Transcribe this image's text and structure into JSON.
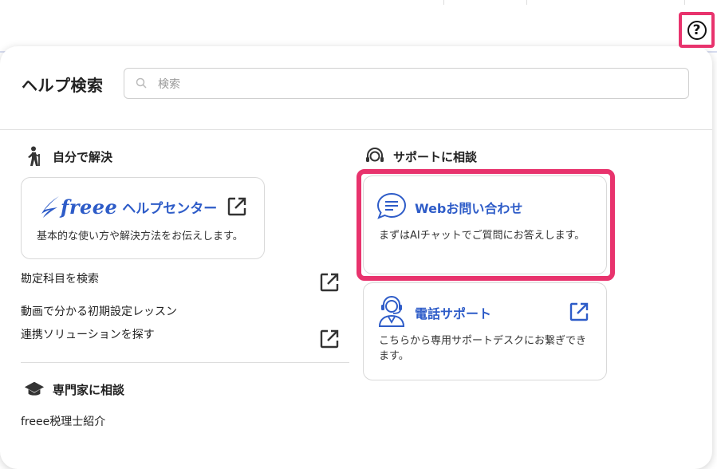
{
  "help_search": {
    "title": "ヘルプ検索",
    "placeholder": "検索"
  },
  "self_solve": {
    "heading": "自分で解決",
    "help_center": {
      "logo_text": "freee",
      "label": "ヘルプセンター",
      "description": "基本的な使い方や解決方法をお伝えします。"
    },
    "links": [
      "勘定科目を検索",
      "動画で分かる初期設定レッスン",
      "連携ソリューションを探す"
    ]
  },
  "expert": {
    "heading": "専門家に相談",
    "links": [
      "freee税理士紹介"
    ]
  },
  "support": {
    "heading": "サポートに相談",
    "web_inquiry": {
      "title": "Webお問い合わせ",
      "description": "まずはAIチャットでご質問にお答えします。"
    },
    "phone_support": {
      "title": "電話サポート",
      "description": "こちらから専用サポートデスクにお繋ぎできます。"
    }
  },
  "colors": {
    "accent_blue": "#2e5cc8",
    "highlight_pink": "#e8336d"
  },
  "icons": [
    "help-icon",
    "search-icon",
    "hiker-icon",
    "external-link-icon",
    "headset-person-icon",
    "chat-bubble-icon",
    "operator-icon",
    "graduation-cap-icon"
  ]
}
